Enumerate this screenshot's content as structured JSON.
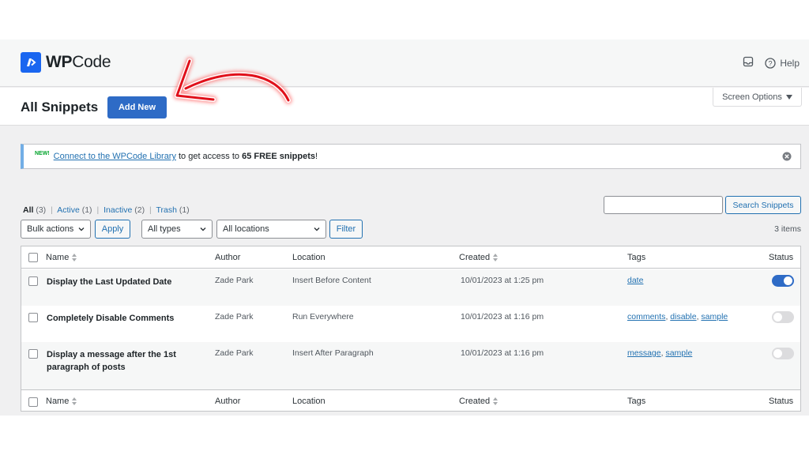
{
  "brand": {
    "logo_prefix": "WP",
    "logo_suffix": "Code"
  },
  "topbar": {
    "help_label": "Help"
  },
  "header": {
    "title": "All Snippets",
    "add_new_label": "Add New",
    "screen_options_label": "Screen Options"
  },
  "notice": {
    "badge": "NEW!",
    "link_text": "Connect to the WPCode Library",
    "text_before_count": "to get access to",
    "count_text": "65 FREE snippets",
    "text_after": "!"
  },
  "filters": {
    "views": [
      {
        "label": "All",
        "count": "(3)"
      },
      {
        "label": "Active",
        "count": "(1)"
      },
      {
        "label": "Inactive",
        "count": "(2)"
      },
      {
        "label": "Trash",
        "count": "(1)"
      }
    ],
    "views_separator": "|",
    "bulk_actions": "Bulk actions",
    "apply_label": "Apply",
    "types": "All types",
    "locations": "All locations",
    "filter_label": "Filter",
    "search_placeholder": "",
    "search_label": "Search Snippets",
    "items_count": "3 items"
  },
  "table": {
    "columns": [
      "Name",
      "Author",
      "Location",
      "Created",
      "Tags",
      "Status"
    ],
    "rows": [
      {
        "name": "Display the Last Updated Date",
        "author": "Zade Park",
        "location": "Insert Before Content",
        "created": "10/01/2023 at 1:25 pm",
        "tags": [
          "date"
        ],
        "active": true
      },
      {
        "name": "Completely Disable Comments",
        "author": "Zade Park",
        "location": "Run Everywhere",
        "created": "10/01/2023 at 1:16 pm",
        "tags": [
          "comments",
          "disable",
          "sample"
        ],
        "active": false
      },
      {
        "name": "Display a message after the 1st paragraph of posts",
        "author": "Zade Park",
        "location": "Insert After Paragraph",
        "created": "10/01/2023 at 1:16 pm",
        "tags": [
          "message",
          "sample"
        ],
        "active": false
      }
    ]
  },
  "colors": {
    "accent": "#2e6bc6",
    "annotation_arrow": "#e0101a",
    "notice_border": "#72aee6"
  }
}
